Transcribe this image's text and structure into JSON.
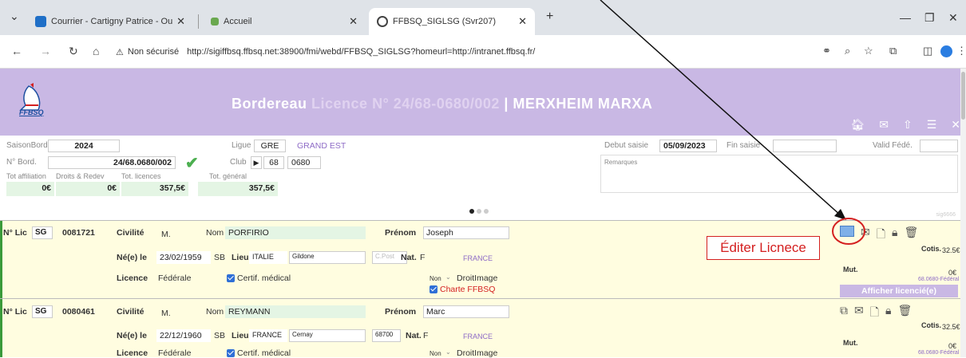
{
  "tabs": [
    {
      "label": "Courrier - Cartigny Patrice - Ou"
    },
    {
      "label": "Accueil"
    },
    {
      "label": "FFBSQ_SIGLSG (Svr207)"
    }
  ],
  "addressbar": {
    "security": "Non sécurisé",
    "url": "http://sigiffbsq.ffbsq.net:38900/fmi/webd/FFBSQ_SIGLSG?homeurl=http://intranet.ffbsq.fr/"
  },
  "header": {
    "logo_text": "FFBSQ",
    "title_part1": "Bordereau ",
    "title_part2": "Licence N° 24/68-0680/002",
    "title_part3": " | MERXHEIM MARXA"
  },
  "form": {
    "saisonbord_label": "SaisonBord",
    "saisonbord_value": "2024",
    "nbord_label": "N° Bord.",
    "nbord_value": "24/68.0680/002",
    "ligue_label": "Ligue",
    "ligue_code": "GRE",
    "ligue_name": "GRAND EST",
    "club_label": "Club",
    "club_num": "68",
    "club_code": "0680",
    "tot_affil_label": "Tot affiliation",
    "droits_label": "Droits & Redev",
    "tot_lic_label": "Tot. licences",
    "tot_gen_label": "Tot. général",
    "tot_affil_value": "0€",
    "droits_value": "0€",
    "tot_lic_value": "357,5€",
    "tot_gen_value": "357,5€",
    "debut_label": "Debut saisie",
    "debut_value": "05/09/2023",
    "fin_label": "Fin saisie",
    "valid_label": "Valid Fédé.",
    "remarques_label": "Remarques",
    "small_right": "sig6666"
  },
  "rows": [
    {
      "nlic_label": "N° Lic",
      "sg": "SG",
      "num": "0081721",
      "civ_label": "Civilité",
      "civ_value": "M.",
      "nom_label": "Nom",
      "nom_value": "PORFIRIO",
      "prenom_label": "Prénom",
      "prenom_value": "Joseph",
      "ne_label": "Né(e) le",
      "ne_value": "23/02/1959",
      "sb": "SB",
      "lieu_label": "Lieu",
      "lieu_value": "ITALIE",
      "ville": "Gildone",
      "cp": "C.Post",
      "nat_label": "Nat.",
      "nat_code": "F",
      "nat_name": "FRANCE",
      "licence_label": "Licence",
      "licence_value": "Fédérale",
      "certif": "Certif. médical",
      "droit_sel": "Non",
      "droit_label": "DroitImage",
      "charte": "Charte FFBSQ",
      "cotis_label": "Cotis.",
      "cotis_value": "32.5€",
      "mut_label": "Mut.",
      "mut_value": "0€",
      "mut_sub": "68.0680-Fédéral",
      "afficher": "Afficher licencié(e)"
    },
    {
      "nlic_label": "N° Lic",
      "sg": "SG",
      "num": "0080461",
      "civ_label": "Civilité",
      "civ_value": "M.",
      "nom_label": "Nom",
      "nom_value": "REYMANN",
      "prenom_label": "Prénom",
      "prenom_value": "Marc",
      "ne_label": "Né(e) le",
      "ne_value": "22/12/1960",
      "sb": "SB",
      "lieu_label": "Lieu",
      "lieu_value": "FRANCE",
      "ville": "Cernay",
      "cp": "68700",
      "nat_label": "Nat.",
      "nat_code": "F",
      "nat_name": "FRANCE",
      "licence_label": "Licence",
      "licence_value": "Fédérale",
      "certif": "Certif. médical",
      "droit_sel": "Non",
      "droit_label": "DroitImage",
      "cotis_label": "Cotis.",
      "cotis_value": "32.5€",
      "mut_label": "Mut.",
      "mut_value": "0€",
      "mut_sub": "68.0680-Fédéral"
    }
  ],
  "annotation": {
    "label": "Éditer Licnece"
  },
  "colors": {
    "header": "#c9b8e4",
    "row_bg": "#fffde0",
    "annotation_red": "#d42020"
  }
}
